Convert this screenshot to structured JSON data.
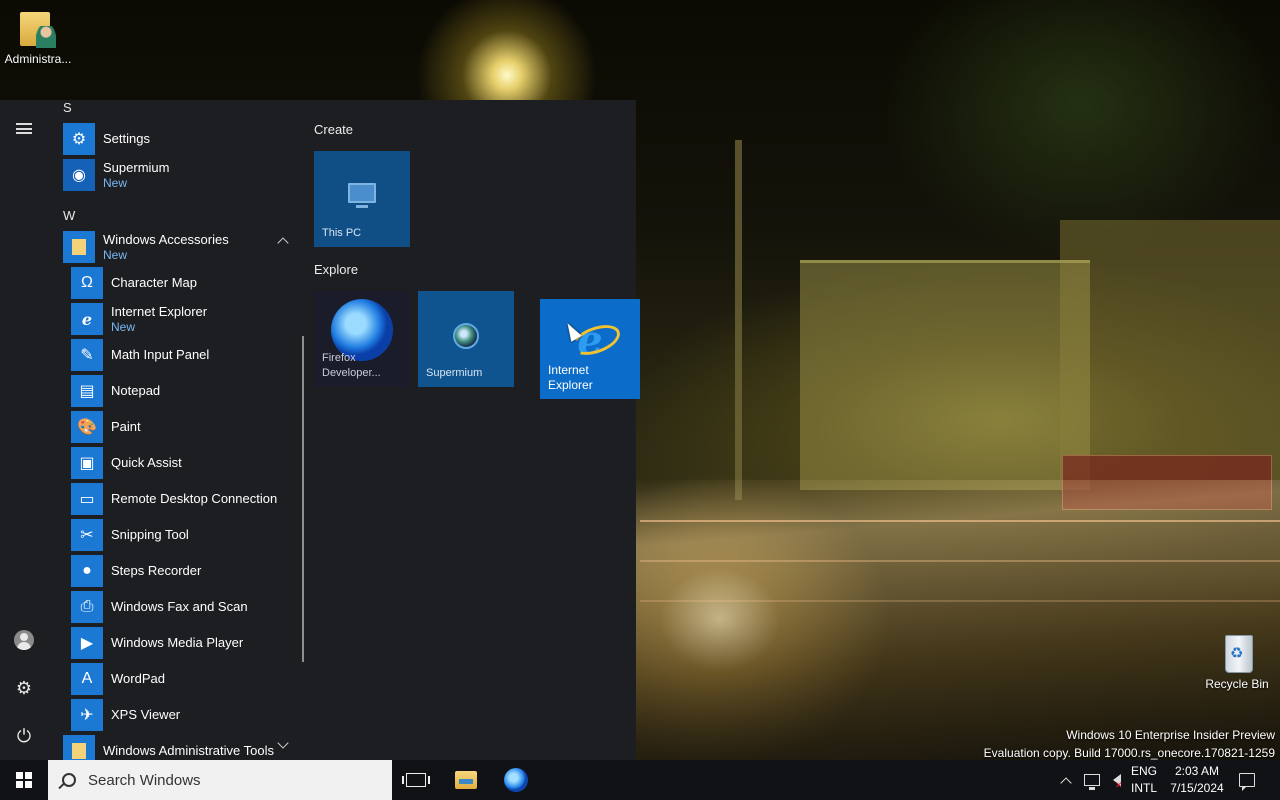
{
  "desktop": {
    "icons": [
      {
        "label": "Administra..."
      },
      {
        "label": "Recycle Bin"
      }
    ],
    "watermark": {
      "line1": "Windows 10 Enterprise Insider Preview",
      "line2": "Evaluation copy. Build 17000.rs_onecore.170821-1259"
    }
  },
  "start_menu": {
    "rail": {
      "menu_icon": "hamburger-icon",
      "account_icon": "user-icon",
      "settings_icon": "gear-icon",
      "power_icon": "power-icon"
    },
    "app_list": {
      "groups": [
        {
          "letter": "S"
        },
        {
          "letter": "W"
        }
      ],
      "settings": {
        "name": "Settings",
        "icon": "gear-icon"
      },
      "supermium": {
        "name": "Supermium",
        "badge": "New",
        "icon": "supermium-icon"
      },
      "windows_accessories": {
        "name": "Windows Accessories",
        "badge": "New",
        "expanded": true
      },
      "accessories": [
        {
          "name": "Character Map",
          "badge": ""
        },
        {
          "name": "Internet Explorer",
          "badge": "New"
        },
        {
          "name": "Math Input Panel",
          "badge": ""
        },
        {
          "name": "Notepad",
          "badge": ""
        },
        {
          "name": "Paint",
          "badge": ""
        },
        {
          "name": "Quick Assist",
          "badge": ""
        },
        {
          "name": "Remote Desktop Connection",
          "badge": ""
        },
        {
          "name": "Snipping Tool",
          "badge": ""
        },
        {
          "name": "Steps Recorder",
          "badge": ""
        },
        {
          "name": "Windows Fax and Scan",
          "badge": ""
        },
        {
          "name": "Windows Media Player",
          "badge": ""
        },
        {
          "name": "WordPad",
          "badge": ""
        },
        {
          "name": "XPS Viewer",
          "badge": ""
        }
      ],
      "windows_admin_tools": {
        "name": "Windows Administrative Tools",
        "expanded": false
      }
    },
    "tiles": {
      "create": {
        "title": "Create",
        "this_pc": "This PC"
      },
      "explore": {
        "title": "Explore",
        "firefox_line1": "Firefox",
        "firefox_line2": "Developer...",
        "supermium": "Supermium",
        "ie_line1": "Internet",
        "ie_line2": "Explorer"
      }
    }
  },
  "taskbar": {
    "search_placeholder": "Search Windows",
    "lang_line1": "ENG",
    "lang_line2": "INTL",
    "time": "2:03 AM",
    "date": "7/15/2024"
  },
  "colors": {
    "accent": "#1b79d4",
    "tile": "#104f86",
    "ie_tile": "#0b6cc9",
    "start_bg": "#1d1e22",
    "new_badge": "#79b8f0",
    "taskbar": "#101216"
  }
}
